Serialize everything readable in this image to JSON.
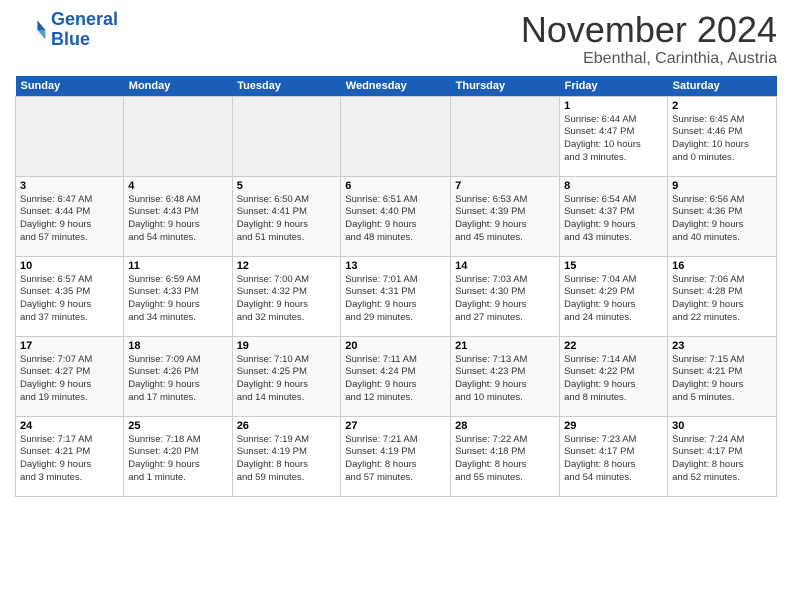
{
  "logo": {
    "line1": "General",
    "line2": "Blue"
  },
  "title": "November 2024",
  "location": "Ebenthal, Carinthia, Austria",
  "weekdays": [
    "Sunday",
    "Monday",
    "Tuesday",
    "Wednesday",
    "Thursday",
    "Friday",
    "Saturday"
  ],
  "weeks": [
    [
      {
        "day": "",
        "info": ""
      },
      {
        "day": "",
        "info": ""
      },
      {
        "day": "",
        "info": ""
      },
      {
        "day": "",
        "info": ""
      },
      {
        "day": "",
        "info": ""
      },
      {
        "day": "1",
        "info": "Sunrise: 6:44 AM\nSunset: 4:47 PM\nDaylight: 10 hours\nand 3 minutes."
      },
      {
        "day": "2",
        "info": "Sunrise: 6:45 AM\nSunset: 4:46 PM\nDaylight: 10 hours\nand 0 minutes."
      }
    ],
    [
      {
        "day": "3",
        "info": "Sunrise: 6:47 AM\nSunset: 4:44 PM\nDaylight: 9 hours\nand 57 minutes."
      },
      {
        "day": "4",
        "info": "Sunrise: 6:48 AM\nSunset: 4:43 PM\nDaylight: 9 hours\nand 54 minutes."
      },
      {
        "day": "5",
        "info": "Sunrise: 6:50 AM\nSunset: 4:41 PM\nDaylight: 9 hours\nand 51 minutes."
      },
      {
        "day": "6",
        "info": "Sunrise: 6:51 AM\nSunset: 4:40 PM\nDaylight: 9 hours\nand 48 minutes."
      },
      {
        "day": "7",
        "info": "Sunrise: 6:53 AM\nSunset: 4:39 PM\nDaylight: 9 hours\nand 45 minutes."
      },
      {
        "day": "8",
        "info": "Sunrise: 6:54 AM\nSunset: 4:37 PM\nDaylight: 9 hours\nand 43 minutes."
      },
      {
        "day": "9",
        "info": "Sunrise: 6:56 AM\nSunset: 4:36 PM\nDaylight: 9 hours\nand 40 minutes."
      }
    ],
    [
      {
        "day": "10",
        "info": "Sunrise: 6:57 AM\nSunset: 4:35 PM\nDaylight: 9 hours\nand 37 minutes."
      },
      {
        "day": "11",
        "info": "Sunrise: 6:59 AM\nSunset: 4:33 PM\nDaylight: 9 hours\nand 34 minutes."
      },
      {
        "day": "12",
        "info": "Sunrise: 7:00 AM\nSunset: 4:32 PM\nDaylight: 9 hours\nand 32 minutes."
      },
      {
        "day": "13",
        "info": "Sunrise: 7:01 AM\nSunset: 4:31 PM\nDaylight: 9 hours\nand 29 minutes."
      },
      {
        "day": "14",
        "info": "Sunrise: 7:03 AM\nSunset: 4:30 PM\nDaylight: 9 hours\nand 27 minutes."
      },
      {
        "day": "15",
        "info": "Sunrise: 7:04 AM\nSunset: 4:29 PM\nDaylight: 9 hours\nand 24 minutes."
      },
      {
        "day": "16",
        "info": "Sunrise: 7:06 AM\nSunset: 4:28 PM\nDaylight: 9 hours\nand 22 minutes."
      }
    ],
    [
      {
        "day": "17",
        "info": "Sunrise: 7:07 AM\nSunset: 4:27 PM\nDaylight: 9 hours\nand 19 minutes."
      },
      {
        "day": "18",
        "info": "Sunrise: 7:09 AM\nSunset: 4:26 PM\nDaylight: 9 hours\nand 17 minutes."
      },
      {
        "day": "19",
        "info": "Sunrise: 7:10 AM\nSunset: 4:25 PM\nDaylight: 9 hours\nand 14 minutes."
      },
      {
        "day": "20",
        "info": "Sunrise: 7:11 AM\nSunset: 4:24 PM\nDaylight: 9 hours\nand 12 minutes."
      },
      {
        "day": "21",
        "info": "Sunrise: 7:13 AM\nSunset: 4:23 PM\nDaylight: 9 hours\nand 10 minutes."
      },
      {
        "day": "22",
        "info": "Sunrise: 7:14 AM\nSunset: 4:22 PM\nDaylight: 9 hours\nand 8 minutes."
      },
      {
        "day": "23",
        "info": "Sunrise: 7:15 AM\nSunset: 4:21 PM\nDaylight: 9 hours\nand 5 minutes."
      }
    ],
    [
      {
        "day": "24",
        "info": "Sunrise: 7:17 AM\nSunset: 4:21 PM\nDaylight: 9 hours\nand 3 minutes."
      },
      {
        "day": "25",
        "info": "Sunrise: 7:18 AM\nSunset: 4:20 PM\nDaylight: 9 hours\nand 1 minute."
      },
      {
        "day": "26",
        "info": "Sunrise: 7:19 AM\nSunset: 4:19 PM\nDaylight: 8 hours\nand 59 minutes."
      },
      {
        "day": "27",
        "info": "Sunrise: 7:21 AM\nSunset: 4:19 PM\nDaylight: 8 hours\nand 57 minutes."
      },
      {
        "day": "28",
        "info": "Sunrise: 7:22 AM\nSunset: 4:18 PM\nDaylight: 8 hours\nand 55 minutes."
      },
      {
        "day": "29",
        "info": "Sunrise: 7:23 AM\nSunset: 4:17 PM\nDaylight: 8 hours\nand 54 minutes."
      },
      {
        "day": "30",
        "info": "Sunrise: 7:24 AM\nSunset: 4:17 PM\nDaylight: 8 hours\nand 52 minutes."
      }
    ]
  ]
}
